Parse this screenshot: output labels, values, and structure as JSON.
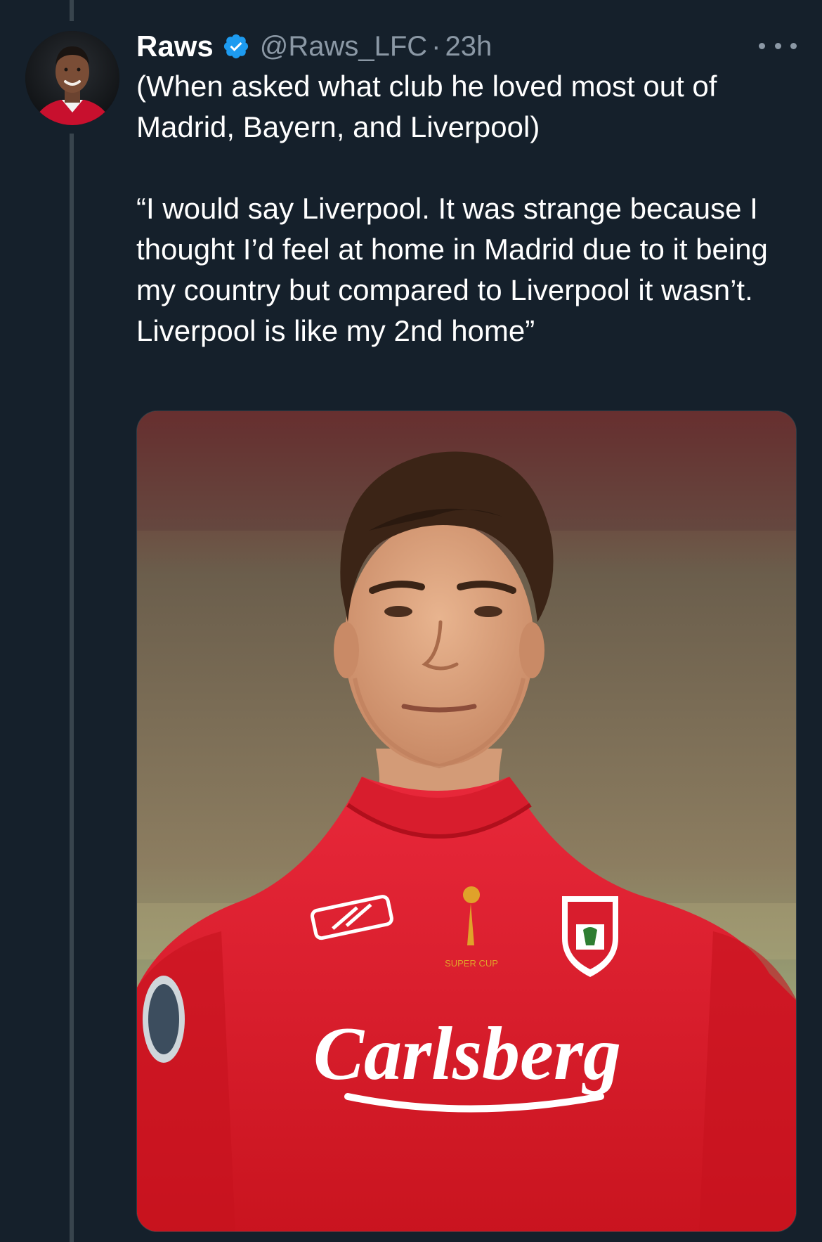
{
  "tweet": {
    "author": {
      "name": "Raws",
      "handle": "@Raws_LFC",
      "verified": true,
      "avatar": "profile-photo-icon"
    },
    "separator": "·",
    "time": "23h",
    "more_icon": "more-horizontal-icon",
    "text": {
      "line1": "(When asked what club he loved most out of Madrid, Bayern, and Liverpool)",
      "line2": "“I would say Liverpool. It was strange because I thought I’d feel at home in Madrid due to it being my country but compared to Liverpool it wasn’t. Liverpool is like my 2nd home”"
    },
    "media": {
      "kind": "photo",
      "jersey_sponsor": "Carlsberg",
      "badge_text": "SUPER CUP",
      "colors": {
        "shirt": "#e01f2f",
        "background_top": "#7a6a55",
        "background_bottom": "#9aa77a"
      }
    }
  },
  "colors": {
    "background": "#15202b",
    "text": "#ffffff",
    "secondary_text": "#8b98a5",
    "verified": "#1d9bf0",
    "thread_line": "#38444d"
  }
}
